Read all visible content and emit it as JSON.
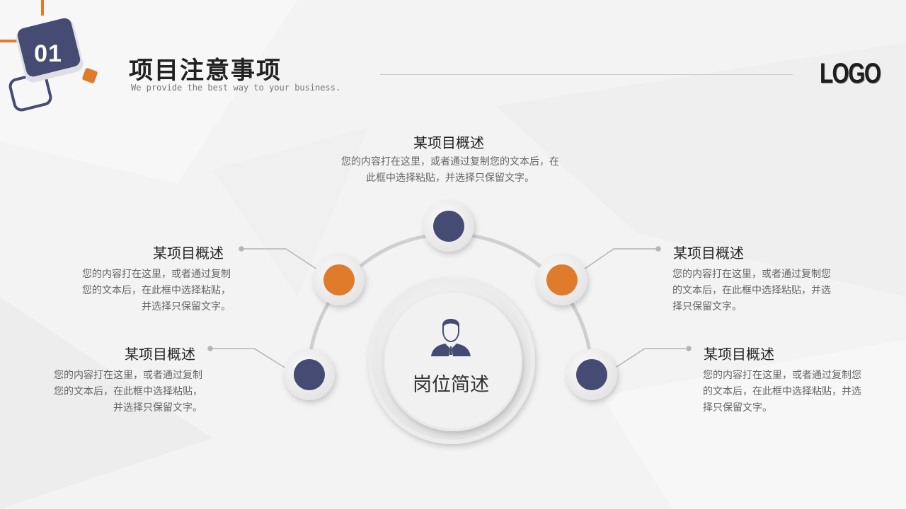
{
  "header": {
    "badge_number": "01",
    "title": "项目注意事项",
    "subtitle": "We provide the best way to  your business.",
    "logo": "LOGO"
  },
  "colors": {
    "navy": "#454b72",
    "orange": "#e07b2c",
    "text_dark": "#222222",
    "text_gray": "#666666"
  },
  "center": {
    "label": "岗位简述",
    "icon": "person-icon"
  },
  "items": {
    "top": {
      "title": "某项目概述",
      "desc_line1": "您的内容打在这里，或者通过复制您的文本后，在",
      "desc_line2": "此框中选择粘贴，并选择只保留文字。"
    },
    "left_upper": {
      "title": "某项目概述",
      "desc_line1": "您的内容打在这里，或者通过复制",
      "desc_line2": "您的文本后，在此框中选择粘贴，",
      "desc_line3": "并选择只保留文字。"
    },
    "left_lower": {
      "title": "某项目概述",
      "desc_line1": "您的内容打在这里，或者通过复制",
      "desc_line2": "您的文本后，在此框中选择粘贴，",
      "desc_line3": "并选择只保留文字。"
    },
    "right_upper": {
      "title": "某项目概述",
      "desc_line1": "您的内容打在这里，或者通过复制您",
      "desc_line2": "的文本后，在此框中选择粘贴，并选",
      "desc_line3": "择只保留文字。"
    },
    "right_lower": {
      "title": "某项目概述",
      "desc_line1": "您的内容打在这里，或者通过复制您",
      "desc_line2": "的文本后，在此框中选择粘贴，并选",
      "desc_line3": "择只保留文字。"
    }
  }
}
